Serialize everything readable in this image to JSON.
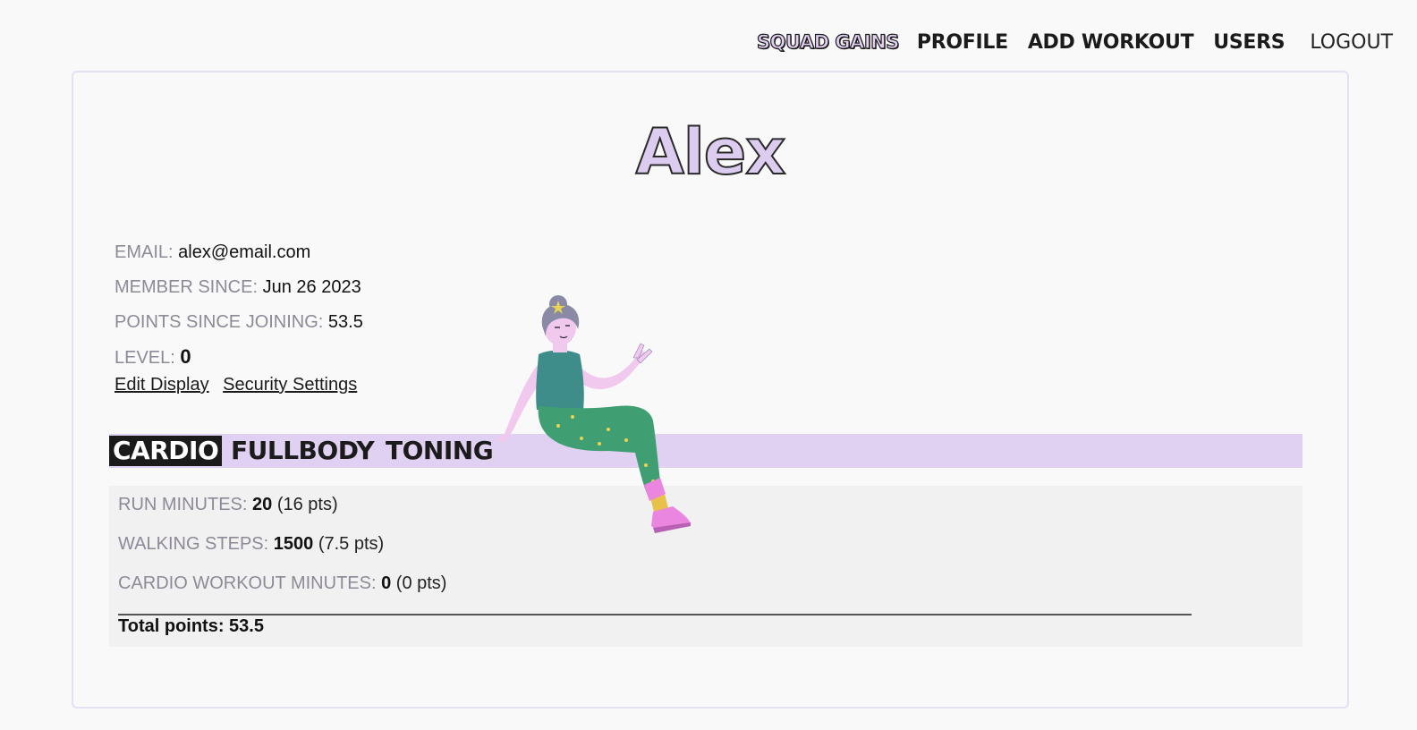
{
  "nav": {
    "brand": "SQUAD GAINS",
    "profile": "PROFILE",
    "add_workout": "ADD WORKOUT",
    "users": "USERS",
    "logout": "LOGOUT"
  },
  "profile": {
    "name": "Alex",
    "email_label": "EMAIL:",
    "email": "alex@email.com",
    "member_since_label": "MEMBER SINCE:",
    "member_since": "Jun 26 2023",
    "points_label": "POINTS SINCE JOINING:",
    "points": "53.5",
    "level_label": "LEVEL:",
    "level": "0",
    "edit_display": "Edit Display",
    "security_settings": "Security Settings"
  },
  "tabs": [
    {
      "label": "CARDIO",
      "active": true
    },
    {
      "label": "FULLBODY",
      "active": false
    },
    {
      "label": "TONING",
      "active": false
    }
  ],
  "stats": [
    {
      "label": "RUN MINUTES:",
      "value": "20",
      "pts": "(16 pts)"
    },
    {
      "label": "WALKING STEPS:",
      "value": "1500",
      "pts": "(7.5 pts)"
    },
    {
      "label": "CARDIO WORKOUT MINUTES:",
      "value": "0",
      "pts": "(0 pts)"
    }
  ],
  "total": "Total points: 53.5",
  "colors": {
    "accent_lavender": "#e0d0f2",
    "label_gray": "#8e8996",
    "panel_gray": "#f2f1f2",
    "ink": "#1b1b1b"
  },
  "icons": {
    "illustration": "sitting-woman-illustration"
  }
}
